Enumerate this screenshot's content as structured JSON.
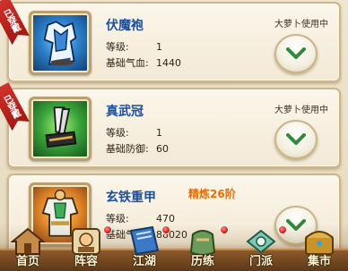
{
  "cards": [
    {
      "badge": "已穿戴",
      "name": "伏魔袍",
      "attr1": {
        "key": "等级:",
        "value": "1"
      },
      "attr2": {
        "key": "基础气血:",
        "value": "1440"
      },
      "user": "大萝卜使用中",
      "icon": "robe-icon"
    },
    {
      "badge": "已穿戴",
      "name": "真武冠",
      "attr1": {
        "key": "等级:",
        "value": "1"
      },
      "attr2": {
        "key": "基础防御:",
        "value": "60"
      },
      "user": "大萝卜使用中",
      "icon": "crown-icon"
    },
    {
      "name": "玄铁重甲",
      "refine": "精炼26阶",
      "attr1": {
        "key": "等级:",
        "value": "470"
      },
      "attr2": {
        "key": "基础气血:",
        "value": "88020"
      },
      "icon": "armor-icon"
    }
  ],
  "nav": [
    {
      "label": "首页",
      "icon": "home-icon",
      "dot": false
    },
    {
      "label": "阵容",
      "icon": "formation-icon",
      "dot": true
    },
    {
      "label": "江湖",
      "icon": "book-icon",
      "dot": true
    },
    {
      "label": "历练",
      "icon": "bag-icon",
      "dot": true
    },
    {
      "label": "门派",
      "icon": "jade-icon",
      "dot": true
    },
    {
      "label": "集市",
      "icon": "treasure-icon",
      "dot": false
    }
  ],
  "colors": {
    "name": "#1a4fa3",
    "refine": "#e86c0c",
    "badge": "#c0241d",
    "button_chevron": "#2f8a3a"
  }
}
